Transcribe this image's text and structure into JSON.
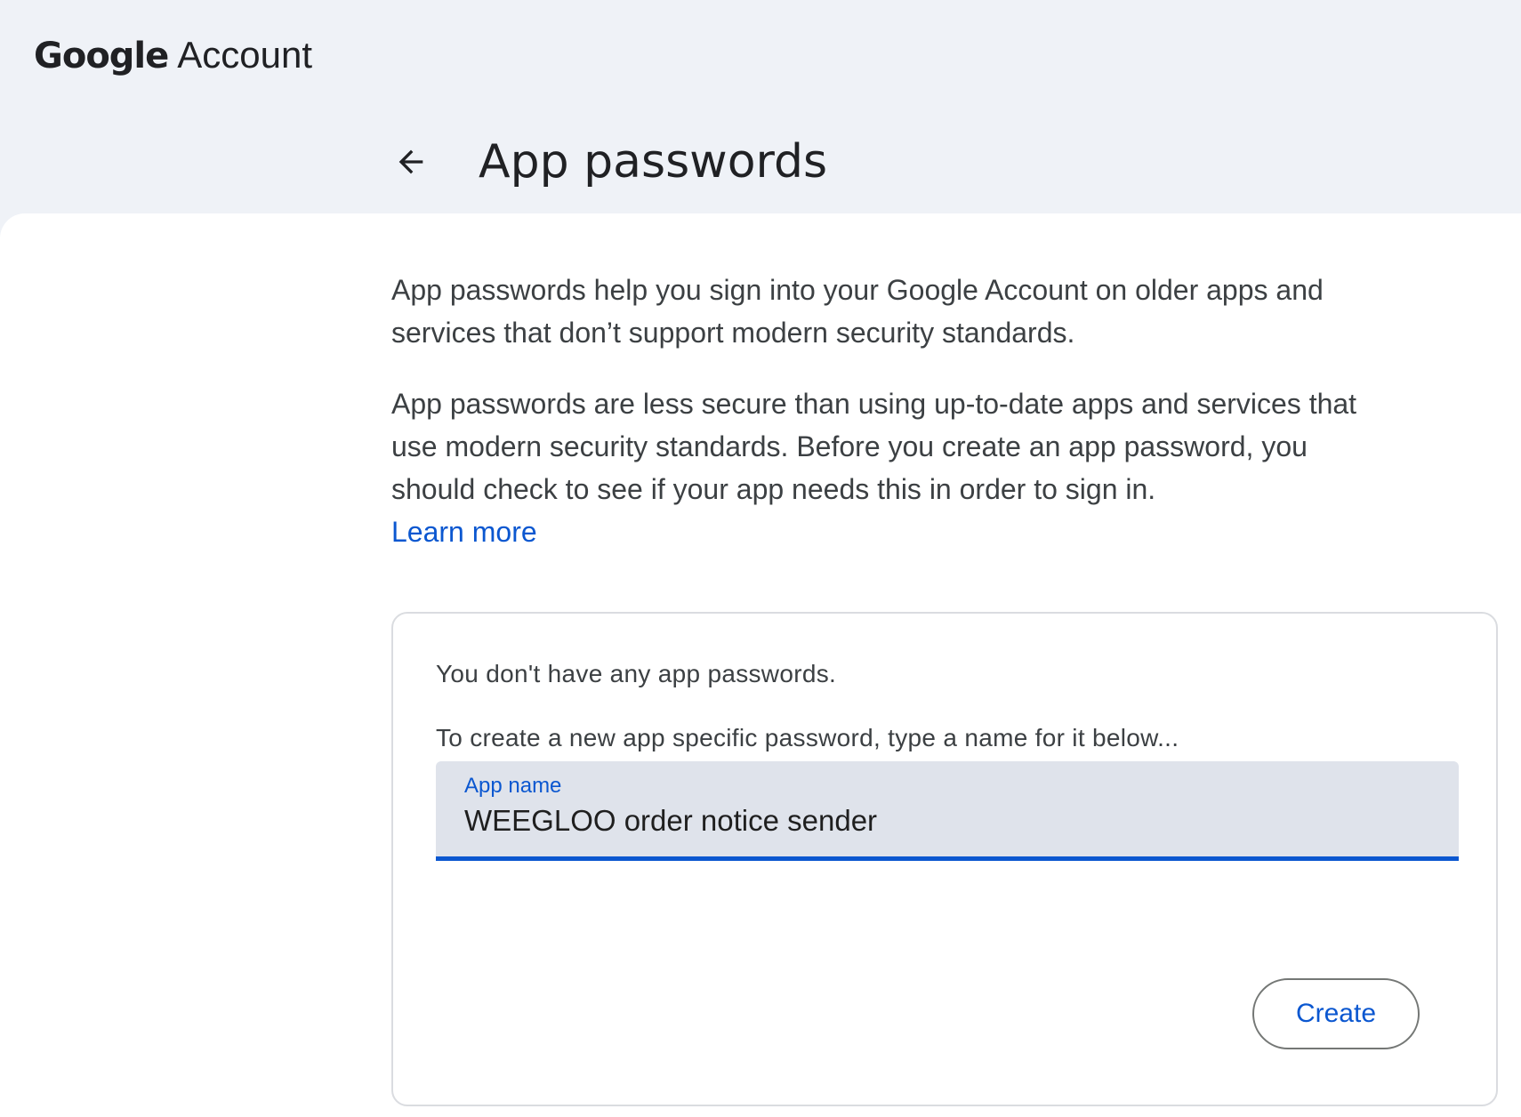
{
  "header": {
    "logo_google": "Google",
    "logo_account": "Account",
    "title": "App passwords",
    "back_icon": "arrow-back-icon"
  },
  "description": {
    "paragraph_1": "App passwords help you sign into your Google Account on older apps and services that don’t support modern security standards.",
    "paragraph_2": "App passwords are less secure than using up-to-date apps and services that use modern security standards. Before you create an app password, you should check to see if your app needs this in order to sign in.",
    "learn_more": "Learn more"
  },
  "card": {
    "empty_message": "You don't have any app passwords.",
    "instruction": "To create a new app specific password, type a name for it below...",
    "field_label": "App name",
    "field_value": "WEEGLOO order notice sender",
    "create_label": "Create"
  },
  "colors": {
    "accent": "#0b57d0",
    "page_bg": "#eff2f7",
    "field_bg": "#dfe3eb",
    "text": "#3c4043"
  }
}
